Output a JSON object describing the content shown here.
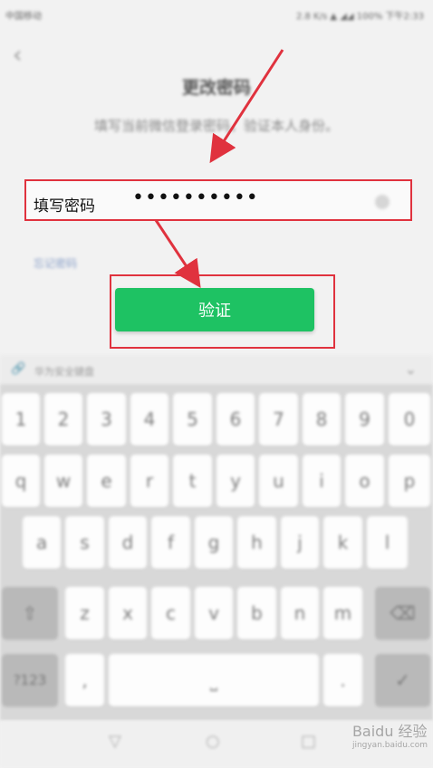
{
  "status_bar": {
    "carrier": "中国移动",
    "right": "2.8 K/s   ▲   ◢◢   100%   下午2:33"
  },
  "page": {
    "title": "更改密码",
    "subtitle": "填写当前微信登录密码，验证本人身份。"
  },
  "password_field": {
    "label": "填写密码",
    "masked_value": "••••••••••"
  },
  "forgot_link": "忘记密码",
  "verify_button": "验证",
  "keyboard": {
    "header_label": "华为安全键盘",
    "row_numbers": [
      "1",
      "2",
      "3",
      "4",
      "5",
      "6",
      "7",
      "8",
      "9",
      "0"
    ],
    "row_1": [
      "q",
      "w",
      "e",
      "r",
      "t",
      "y",
      "u",
      "i",
      "o",
      "p"
    ],
    "row_2": [
      "a",
      "s",
      "d",
      "f",
      "g",
      "h",
      "j",
      "k",
      "l"
    ],
    "row_3": [
      "z",
      "x",
      "c",
      "v",
      "b",
      "n",
      "m"
    ],
    "symbols_key": "?123",
    "comma_key": ",",
    "period_key": "."
  },
  "annotation_color": "#e0323e",
  "button_color": "#1ec263",
  "watermark": {
    "text": "Baidu 经验",
    "sub": "jingyan.baidu.com"
  }
}
